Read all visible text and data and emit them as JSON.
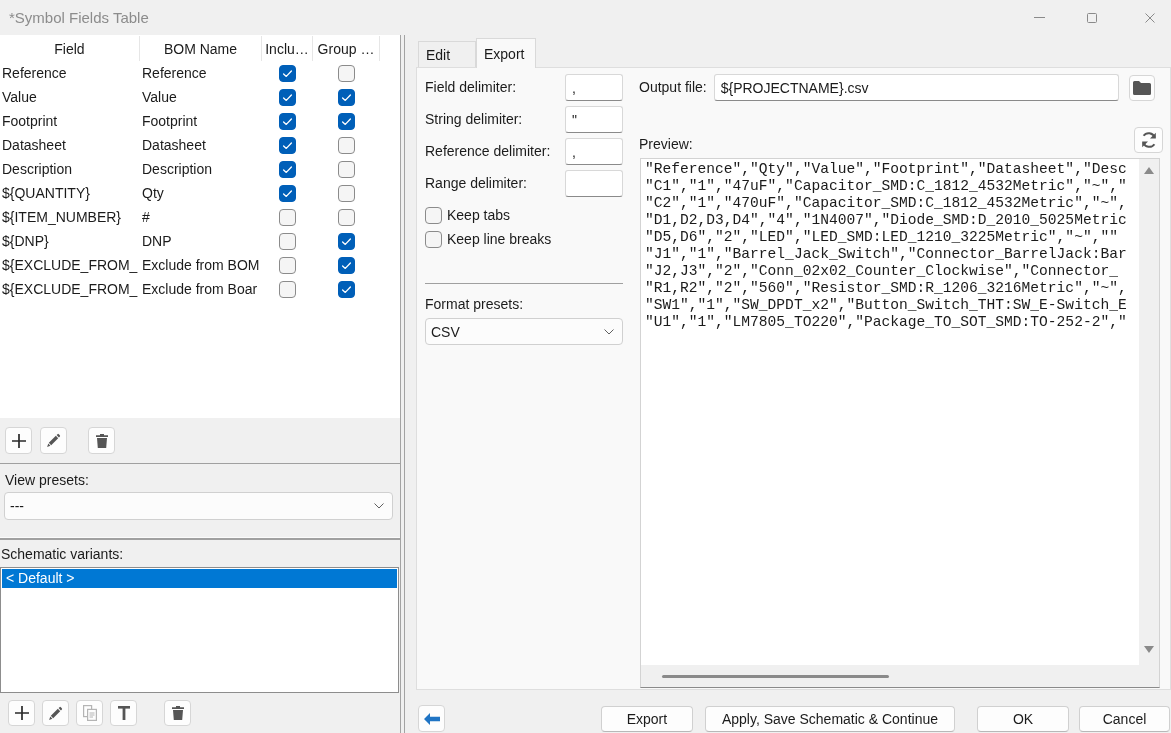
{
  "window": {
    "title": "*Symbol Fields Table"
  },
  "fields_table": {
    "columns": [
      "Field",
      "BOM Name",
      "Inclu…",
      "Group …"
    ],
    "rows": [
      {
        "field": "Reference",
        "bom_name": "Reference",
        "column_3": true,
        "column_4": false
      },
      {
        "field": "Value",
        "bom_name": "Value",
        "column_3": true,
        "column_4": true
      },
      {
        "field": "Footprint",
        "bom_name": "Footprint",
        "column_3": true,
        "column_4": true
      },
      {
        "field": "Datasheet",
        "bom_name": "Datasheet",
        "column_3": true,
        "column_4": false
      },
      {
        "field": "Description",
        "bom_name": "Description",
        "column_3": true,
        "column_4": false
      },
      {
        "field": "${QUANTITY}",
        "bom_name": "Qty",
        "column_3": true,
        "column_4": false
      },
      {
        "field": "${ITEM_NUMBER}",
        "bom_name": "#",
        "column_3": false,
        "column_4": false
      },
      {
        "field": "${DNP}",
        "bom_name": "DNP",
        "column_3": false,
        "column_4": true
      },
      {
        "field": "${EXCLUDE_FROM_",
        "bom_name": "Exclude from BOM",
        "column_3": false,
        "column_4": true
      },
      {
        "field": "${EXCLUDE_FROM_",
        "bom_name": "Exclude from Boar",
        "column_3": false,
        "column_4": true
      }
    ]
  },
  "view_presets": {
    "label": "View presets:",
    "value": "---"
  },
  "schematic_variants": {
    "label": "Schematic variants:",
    "items": [
      {
        "label": "< Default >",
        "selected": true
      }
    ]
  },
  "variant_buttons": [
    {
      "disabled": false
    },
    {
      "disabled": false
    },
    {
      "disabled": true
    },
    {
      "disabled": false
    },
    {
      "disabled": false
    }
  ],
  "tabs": [
    {
      "label": "Edit",
      "selected": false
    },
    {
      "label": "Export",
      "selected": true
    }
  ],
  "export": {
    "delimiters": [
      {
        "label": "Field delimiter:",
        "value": ","
      },
      {
        "label": "String delimiter:",
        "value": "\""
      },
      {
        "label": "Reference delimiter:",
        "value": ","
      },
      {
        "label": "Range delimiter:"
      }
    ],
    "options": [
      {
        "label": "Keep tabs",
        "checked": false
      },
      {
        "label": "Keep line breaks",
        "checked": false
      }
    ],
    "format_presets": {
      "label": "Format presets:",
      "value": "CSV"
    },
    "output_file": {
      "label": "Output file:",
      "value": "${PROJECTNAME}.csv"
    },
    "preview": {
      "label": "Preview:",
      "lines": [
        "\"Reference\",\"Qty\",\"Value\",\"Footprint\",\"Datasheet\",\"Desc",
        "\"C1\",\"1\",\"47uF\",\"Capacitor_SMD:C_1812_4532Metric\",\"~\",\"",
        "\"C2\",\"1\",\"470uF\",\"Capacitor_SMD:C_1812_4532Metric\",\"~\",",
        "\"D1,D2,D3,D4\",\"4\",\"1N4007\",\"Diode_SMD:D_2010_5025Metric",
        "\"D5,D6\",\"2\",\"LED\",\"LED_SMD:LED_1210_3225Metric\",\"~\",\"\"",
        "\"J1\",\"1\",\"Barrel_Jack_Switch\",\"Connector_BarrelJack:Bar",
        "\"J2,J3\",\"2\",\"Conn_02x02_Counter_Clockwise\",\"Connector_",
        "\"R1,R2\",\"2\",\"560\",\"Resistor_SMD:R_1206_3216Metric\",\"~\",",
        "\"SW1\",\"1\",\"SW_DPDT_x2\",\"Button_Switch_THT:SW_E-Switch_E",
        "\"U1\",\"1\",\"LM7805_TO220\",\"Package_TO_SOT_SMD:TO-252-2\",\""
      ]
    }
  },
  "buttons": [
    {
      "label": "Export"
    },
    {
      "label": "Apply, Save Schematic & Continue"
    },
    {
      "label": "OK"
    },
    {
      "label": "Cancel"
    }
  ]
}
